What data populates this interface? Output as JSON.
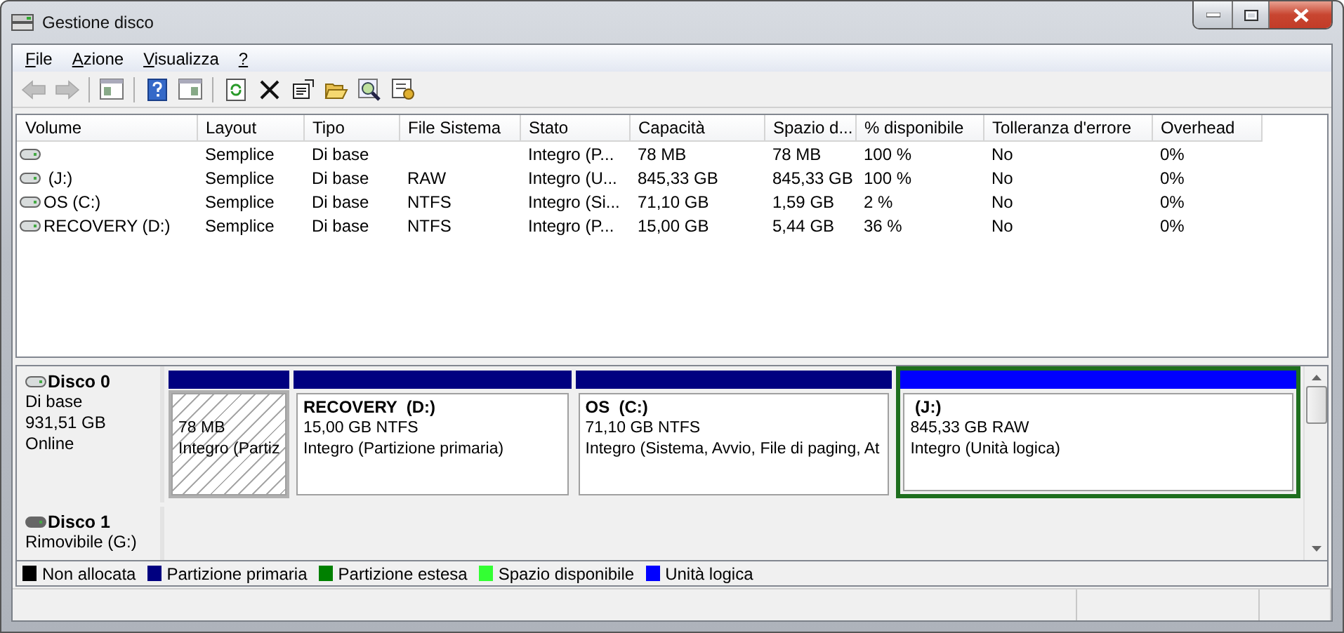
{
  "window": {
    "title": "Gestione disco"
  },
  "menu": [
    "File",
    "Azione",
    "Visualizza",
    "?"
  ],
  "toolbar": [
    {
      "kind": "back",
      "disabled": true
    },
    {
      "kind": "forward",
      "disabled": true
    },
    {
      "kind": "sep"
    },
    {
      "kind": "tree",
      "disabled": false
    },
    {
      "kind": "sep"
    },
    {
      "kind": "help",
      "disabled": false
    },
    {
      "kind": "pane",
      "disabled": false
    },
    {
      "kind": "sep"
    },
    {
      "kind": "refresh",
      "disabled": false
    },
    {
      "kind": "delete",
      "disabled": false
    },
    {
      "kind": "properties",
      "disabled": false
    },
    {
      "kind": "open",
      "disabled": false
    },
    {
      "kind": "explore",
      "disabled": false
    },
    {
      "kind": "settings",
      "disabled": false
    }
  ],
  "table": {
    "columns": [
      "Volume",
      "Layout",
      "Tipo",
      "File Sistema",
      "Stato",
      "Capacità",
      "Spazio d...",
      "% disponibile",
      "Tolleranza d'errore",
      "Overhead"
    ],
    "rows": [
      {
        "cells": [
          "",
          "Semplice",
          "Di base",
          "",
          "Integro (P...",
          "78 MB",
          "78 MB",
          "100 %",
          "No",
          "0%"
        ]
      },
      {
        "cells": [
          " (J:)",
          "Semplice",
          "Di base",
          "RAW",
          "Integro (U...",
          "845,33 GB",
          "845,33 GB",
          "100 %",
          "No",
          "0%"
        ]
      },
      {
        "cells": [
          "OS (C:)",
          "Semplice",
          "Di base",
          "NTFS",
          "Integro (Si...",
          "71,10 GB",
          "1,59 GB",
          "2 %",
          "No",
          "0%"
        ]
      },
      {
        "cells": [
          "RECOVERY (D:)",
          "Semplice",
          "Di base",
          "NTFS",
          "Integro (P...",
          "15,00 GB",
          "5,44 GB",
          "36 %",
          "No",
          "0%"
        ]
      }
    ]
  },
  "disks": [
    {
      "name": "Disco 0",
      "kind": "fixed",
      "lines": [
        "Di base",
        "931,51 GB",
        "Online"
      ],
      "partitions": [
        {
          "size": "78 MB",
          "status": "Integro (Partiz",
          "color": "#000080",
          "hatched": true,
          "selected": false
        },
        {
          "name": "RECOVERY  (D:)",
          "size": "15,00 GB NTFS",
          "status": "Integro (Partizione primaria)",
          "color": "#000080",
          "hatched": false,
          "selected": false
        },
        {
          "name": "OS  (C:)",
          "size": "71,10 GB NTFS",
          "status": "Integro (Sistema, Avvio, File di paging, At",
          "color": "#000080",
          "hatched": false,
          "selected": false
        },
        {
          "name": " (J:)",
          "size": "845,33 GB RAW",
          "status": "Integro (Unità logica)",
          "color": "#0000ff",
          "hatched": false,
          "selected": true
        }
      ]
    },
    {
      "name": "Disco 1",
      "kind": "removable",
      "lines": [
        "Rimovibile (G:)"
      ]
    }
  ],
  "legend": [
    {
      "label": "Non allocata",
      "color": "#000000"
    },
    {
      "label": "Partizione primaria",
      "color": "#000080"
    },
    {
      "label": "Partizione estesa",
      "color": "#008000"
    },
    {
      "label": "Spazio disponibile",
      "color": "#33ff33"
    },
    {
      "label": "Unità logica",
      "color": "#0000ff"
    }
  ]
}
